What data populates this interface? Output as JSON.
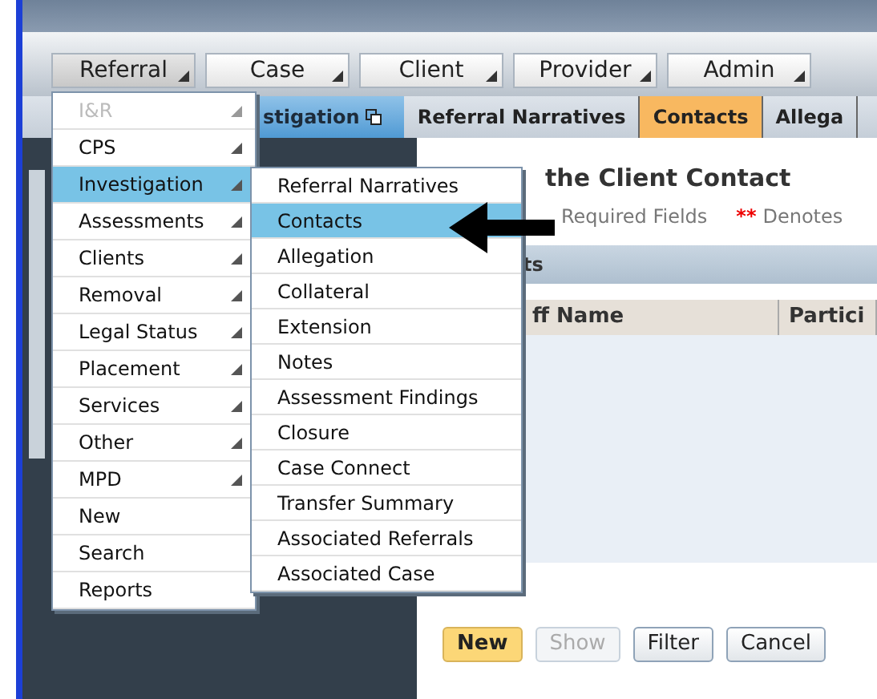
{
  "menu_bar": [
    {
      "label": "Referral",
      "selected": true
    },
    {
      "label": "Case",
      "selected": false
    },
    {
      "label": "Client",
      "selected": false
    },
    {
      "label": "Provider",
      "selected": false
    },
    {
      "label": "Admin",
      "selected": false
    }
  ],
  "breadcrumb": [
    {
      "label": "stigation",
      "kind": "current",
      "selected": false
    },
    {
      "label": "Referral Narratives",
      "kind": "tab",
      "selected": false
    },
    {
      "label": "Contacts",
      "kind": "tab",
      "selected": true
    },
    {
      "label": "Allega",
      "kind": "tab",
      "selected": false
    }
  ],
  "content": {
    "title": "the Client Contact",
    "required_note": "Required Fields",
    "marker": "**",
    "marker_note": "Denotes",
    "section": "ts",
    "columns": [
      "ff Name",
      "Partici"
    ]
  },
  "buttons": [
    {
      "label": "New",
      "kind": "primary",
      "disabled": false
    },
    {
      "label": "Show",
      "kind": "normal",
      "disabled": true
    },
    {
      "label": "Filter",
      "kind": "normal",
      "disabled": false
    },
    {
      "label": "Cancel",
      "kind": "normal",
      "disabled": false
    }
  ],
  "menu": [
    {
      "label": "I&R",
      "disabled": true,
      "has_submenu": true,
      "selected": false
    },
    {
      "label": "CPS",
      "disabled": false,
      "has_submenu": true,
      "selected": false
    },
    {
      "label": "Investigation",
      "disabled": false,
      "has_submenu": true,
      "selected": true
    },
    {
      "label": "Assessments",
      "disabled": false,
      "has_submenu": true,
      "selected": false
    },
    {
      "label": "Clients",
      "disabled": false,
      "has_submenu": true,
      "selected": false
    },
    {
      "label": "Removal",
      "disabled": false,
      "has_submenu": true,
      "selected": false
    },
    {
      "label": "Legal Status",
      "disabled": false,
      "has_submenu": true,
      "selected": false
    },
    {
      "label": "Placement",
      "disabled": false,
      "has_submenu": true,
      "selected": false
    },
    {
      "label": "Services",
      "disabled": false,
      "has_submenu": true,
      "selected": false
    },
    {
      "label": "Other",
      "disabled": false,
      "has_submenu": true,
      "selected": false
    },
    {
      "label": "MPD",
      "disabled": false,
      "has_submenu": true,
      "selected": false
    },
    {
      "label": "New",
      "disabled": false,
      "has_submenu": false,
      "selected": false
    },
    {
      "label": "Search",
      "disabled": false,
      "has_submenu": false,
      "selected": false
    },
    {
      "label": "Reports",
      "disabled": false,
      "has_submenu": false,
      "selected": false
    }
  ],
  "submenu": [
    {
      "label": "Referral Narratives",
      "selected": false
    },
    {
      "label": "Contacts",
      "selected": true
    },
    {
      "label": "Allegation",
      "selected": false
    },
    {
      "label": "Collateral",
      "selected": false
    },
    {
      "label": "Extension",
      "selected": false
    },
    {
      "label": "Notes",
      "selected": false
    },
    {
      "label": "Assessment Findings",
      "selected": false
    },
    {
      "label": "Closure",
      "selected": false
    },
    {
      "label": "Case Connect",
      "selected": false
    },
    {
      "label": "Transfer Summary",
      "selected": false
    },
    {
      "label": "Associated Referrals",
      "selected": false
    },
    {
      "label": "Associated Case",
      "selected": false
    }
  ]
}
